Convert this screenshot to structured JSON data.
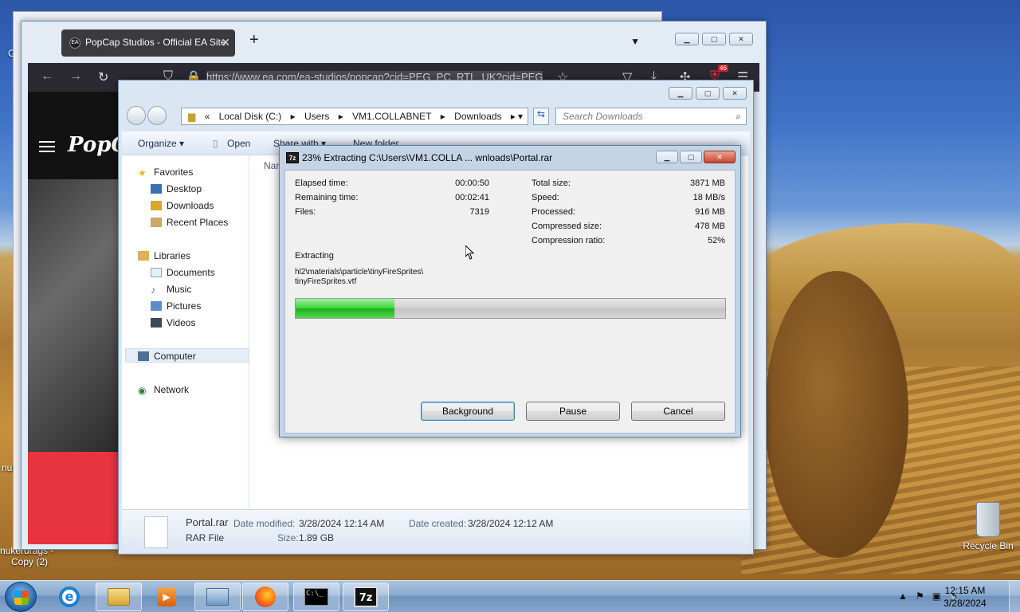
{
  "desktop": {
    "recycle_bin": "Recycle Bin",
    "icon_texts": [
      "nukerdrags -",
      "Copy (2)",
      "nuke",
      "C"
    ]
  },
  "browser": {
    "tab_title": "PopCap Studios - Official EA Site",
    "tab_close": "✕",
    "new_tab": "+",
    "url": "https://www.ea.com/ea-studios/popcap?cid=PEG_PC_RTL_UK?cid=PEG",
    "badge": "46",
    "site_logo": "PopCap"
  },
  "explorer": {
    "breadcrumb": [
      "«",
      "Local Disk (C:)",
      "Users",
      "VM1.COLLABNET",
      "Downloads"
    ],
    "search_placeholder": "Search Downloads",
    "toolbar": {
      "organize": "Organize ▾",
      "open": "Open",
      "share_with": "Share with ▾",
      "new_folder": "New folder"
    },
    "nav": {
      "favorites": "Favorites",
      "desktop": "Desktop",
      "downloads": "Downloads",
      "recent": "Recent Places",
      "libraries": "Libraries",
      "documents": "Documents",
      "music": "Music",
      "pictures": "Pictures",
      "videos": "Videos",
      "computer": "Computer",
      "network": "Network"
    },
    "name_col": "Nar",
    "details": {
      "file_name": "Portal.rar",
      "file_type": "RAR File",
      "date_modified_label": "Date modified:",
      "date_modified": "3/28/2024 12:14 AM",
      "date_created_label": "Date created:",
      "date_created": "3/28/2024 12:12 AM",
      "size_label": "Size:",
      "size": "1.89 GB"
    }
  },
  "dialog": {
    "title": "23% Extracting C:\\Users\\VM1.COLLA ... wnloads\\Portal.rar",
    "icon_label": "7z",
    "left": [
      {
        "label": "Elapsed time:",
        "value": "00:00:50"
      },
      {
        "label": "Remaining time:",
        "value": "00:02:41"
      },
      {
        "label": "Files:",
        "value": "7319"
      }
    ],
    "right": [
      {
        "label": "Total size:",
        "value": "3871 MB"
      },
      {
        "label": "Speed:",
        "value": "18 MB/s"
      },
      {
        "label": "Processed:",
        "value": "916 MB"
      },
      {
        "label": "Compressed size:",
        "value": "478 MB"
      },
      {
        "label": "Compression ratio:",
        "value": "52%"
      }
    ],
    "extracting_label": "Extracting",
    "current_path_1": "hl2\\materials\\particle\\tinyFireSprites\\",
    "current_path_2": "tinyFireSprites.vtf",
    "progress_percent": 23,
    "buttons": {
      "background": "Background",
      "pause": "Pause",
      "cancel": "Cancel"
    }
  },
  "taskbar": {
    "time": "12:15 AM",
    "date": "3/28/2024",
    "sevenzip_label": "7z",
    "cmd_label": "C:\\_"
  }
}
